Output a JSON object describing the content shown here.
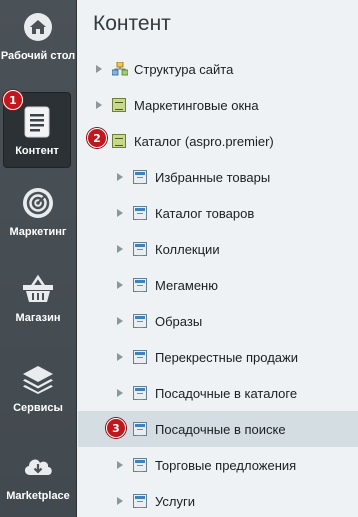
{
  "sidebar": {
    "items": [
      {
        "label": "Рабочий стол",
        "icon": "home-icon"
      },
      {
        "label": "Контент",
        "icon": "document-icon",
        "active": true
      },
      {
        "label": "Маркетинг",
        "icon": "target-icon"
      },
      {
        "label": "Магазин",
        "icon": "basket-icon"
      },
      {
        "label": "Сервисы",
        "icon": "layers-icon"
      },
      {
        "label": "Marketplace",
        "icon": "cloud-download-icon"
      }
    ]
  },
  "main": {
    "title": "Контент",
    "tree": [
      {
        "label": "Структура сайта",
        "level": 0,
        "icon": "site-structure-icon"
      },
      {
        "label": "Маркетинговые окна",
        "level": 0,
        "icon": "list-icon"
      },
      {
        "label": "Каталог (aspro.premier)",
        "level": 0,
        "icon": "list-icon"
      },
      {
        "label": "Избранные товары",
        "level": 1,
        "icon": "infoblock-icon"
      },
      {
        "label": "Каталог товаров",
        "level": 1,
        "icon": "infoblock-icon"
      },
      {
        "label": "Коллекции",
        "level": 1,
        "icon": "infoblock-icon"
      },
      {
        "label": "Мегаменю",
        "level": 1,
        "icon": "infoblock-icon"
      },
      {
        "label": "Образы",
        "level": 1,
        "icon": "infoblock-icon"
      },
      {
        "label": "Перекрестные продажи",
        "level": 1,
        "icon": "infoblock-icon"
      },
      {
        "label": "Посадочные в каталоге",
        "level": 1,
        "icon": "infoblock-icon"
      },
      {
        "label": "Посадочные в поиске",
        "level": 1,
        "icon": "infoblock-icon",
        "selected": true
      },
      {
        "label": "Торговые предложения",
        "level": 1,
        "icon": "infoblock-icon"
      },
      {
        "label": "Услуги",
        "level": 1,
        "icon": "infoblock-icon"
      }
    ]
  },
  "badges": [
    "1",
    "2",
    "3"
  ],
  "colors": {
    "sidebar": "#474e54",
    "active": "#2c3136",
    "badge": "#c1171d",
    "selected_row": "#d3dde2"
  }
}
